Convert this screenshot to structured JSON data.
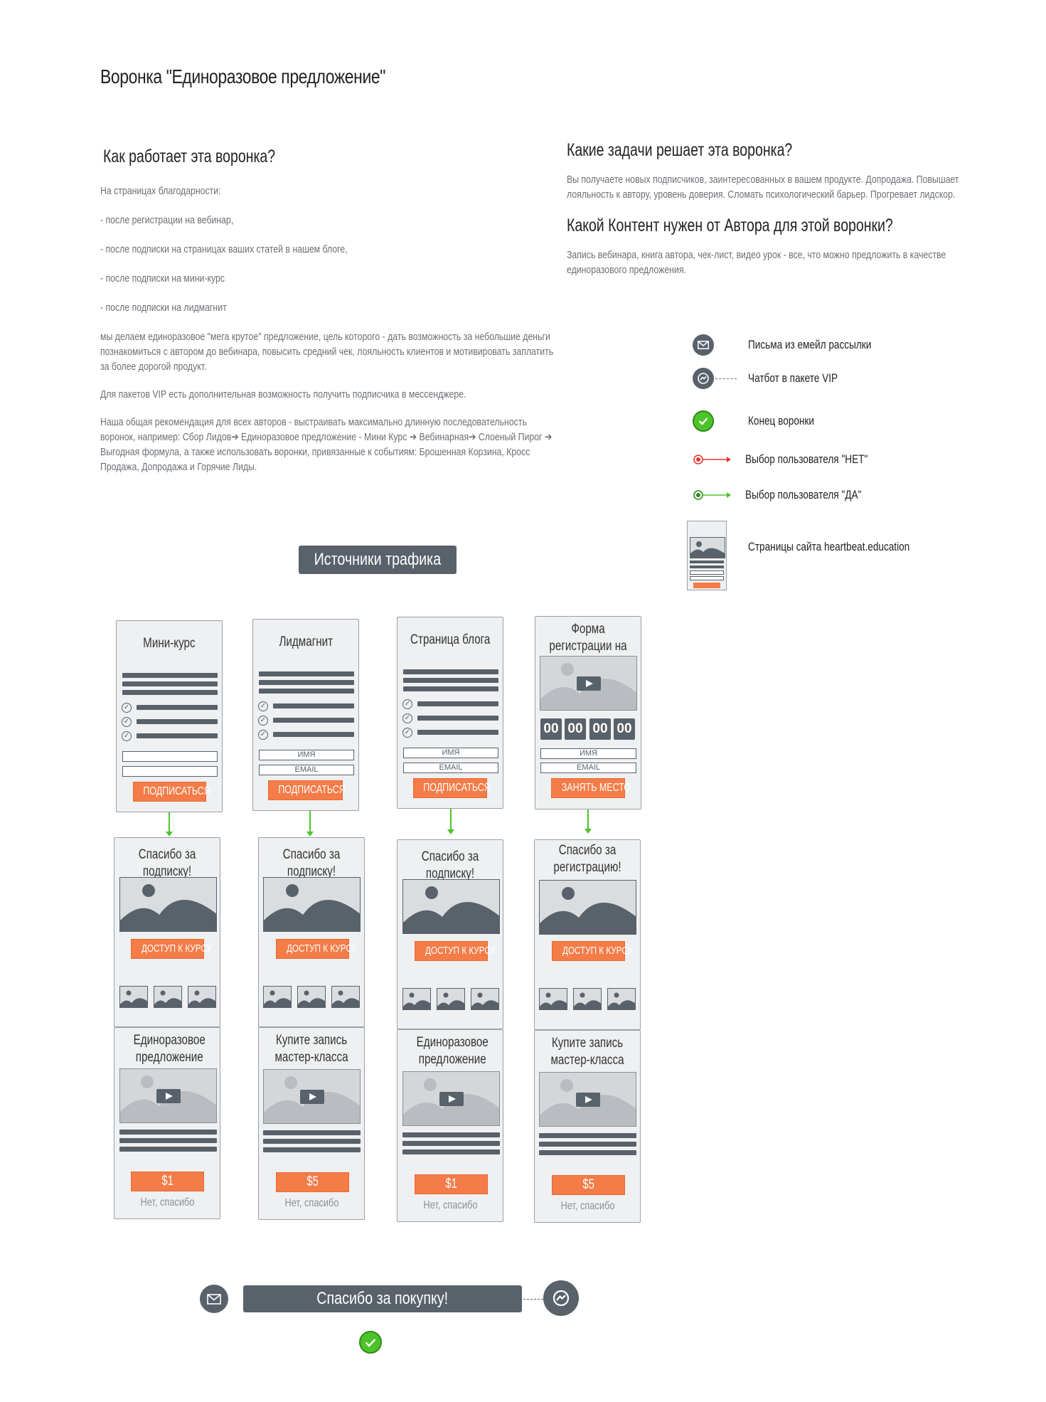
{
  "title": "Воронка \"Единоразовое предложение\"",
  "how": {
    "heading": "Как работает эта воронка?",
    "paragraphs": [
      "На страницах благодарности:",
      "- после регистрации на вебинар,",
      "- после подписки на страницах ваших статей в нашем блоге,",
      "- после подписки на мини-курс",
      "- после подписки на лидмагнит",
      "мы делаем единоразовое \"мега крутое\" предложение, цель которого - дать возможность за небольшие деньги познакомиться с автором до вебинара, повысить средний чек, лояльность клиентов и мотивировать заплатить за более дорогой продукт.",
      "Для пакетов VIP есть дополнительная возможность получить подписчика в мессенджере.",
      "Наша общая рекомендация для всех авторов - выстраивать максимально длинную  последовательность воронок, например: Сбор Лидов➔ Единоразовое предложение  - Мини Курс ➔ Вебинарная➔ Слоеный Пирог ➔ Выгодная формула, а также использовать воронки, привязанные к событиям: Брошенная Корзина, Кросс Продажа, Допродажа и  Горячие Лиды."
    ]
  },
  "tasks": {
    "heading": "Какие задачи решает эта воронка?",
    "text": "Вы получаете новых подписчиков, заинтересованных в вашем продукте. Допродажа.  Повышает лояльность к автору, уровень доверия. Сломать психологический барьер. Прогревает лидскор."
  },
  "content": {
    "heading": "Какой Контент нужен от Автора для этой воронки?",
    "text": "Запись вебинара, книга автора, чек-лист, видео урок - все, что можно предложить в качестве единоразового предложения."
  },
  "legend": {
    "email": "Письма из емейл рассылки",
    "chatbot": "Чатбот в пакете VIP",
    "end": "Конец воронки",
    "no": "Выбор пользователя \"НЕТ\"",
    "yes": "Выбор пользователя \"ДА\"",
    "pages": "Страницы сайта heartbeat.education"
  },
  "sources_label": "Источники трафика",
  "columns": [
    {
      "source_title": "Мини-курс",
      "source_button": "ПОДПИСАТЬСЯ",
      "fields": [
        "",
        ""
      ],
      "thanks_title": "Спасибо за подписку!",
      "thanks_button": "ДОСТУП К КУРСУ",
      "offer_title": "Единоразовое предложение",
      "price": "$1",
      "no_thanks": "Нет, спасибо"
    },
    {
      "source_title": "Лидмагнит",
      "source_button": "ПОДПИСАТЬСЯ",
      "fields": [
        "ИМЯ",
        "EMAIL"
      ],
      "thanks_title": "Спасибо за подписку!",
      "thanks_button": "ДОСТУП К КУРСУ",
      "offer_title": "Купите запись мастер-класса",
      "price": "$5",
      "no_thanks": "Нет, спасибо"
    },
    {
      "source_title": "Страница блога",
      "source_button": "ПОДПИСАТЬСЯ",
      "fields": [
        "ИМЯ",
        "EMAIL"
      ],
      "thanks_title": "Спасибо за подписку!",
      "thanks_button": "ДОСТУП К КУРСУ",
      "offer_title": "Единоразовое предложение",
      "price": "$1",
      "no_thanks": "Нет, спасибо"
    },
    {
      "source_title": "Форма регистрации на вебинар",
      "source_button": "ЗАНЯТЬ МЕСТО",
      "fields": [
        "ИМЯ",
        "EMAIL"
      ],
      "timer": [
        "00",
        "00",
        "00",
        "00"
      ],
      "thanks_title": "Спасибо за регистрацию!",
      "thanks_button": "ДОСТУП К КУРСУ",
      "offer_title": "Купите запись мастер-класса",
      "price": "$5",
      "no_thanks": "Нет, спасибо"
    }
  ],
  "purchase_label": "Спасибо за покупку!",
  "colors": {
    "dark": "#59616b",
    "orange": "#f47c48",
    "green": "#4cc429",
    "red": "#e53935",
    "card_bg": "#eef0f1"
  },
  "icons": [
    "mail-icon",
    "messenger-icon",
    "check-icon",
    "play-icon",
    "mountain-image-icon"
  ]
}
